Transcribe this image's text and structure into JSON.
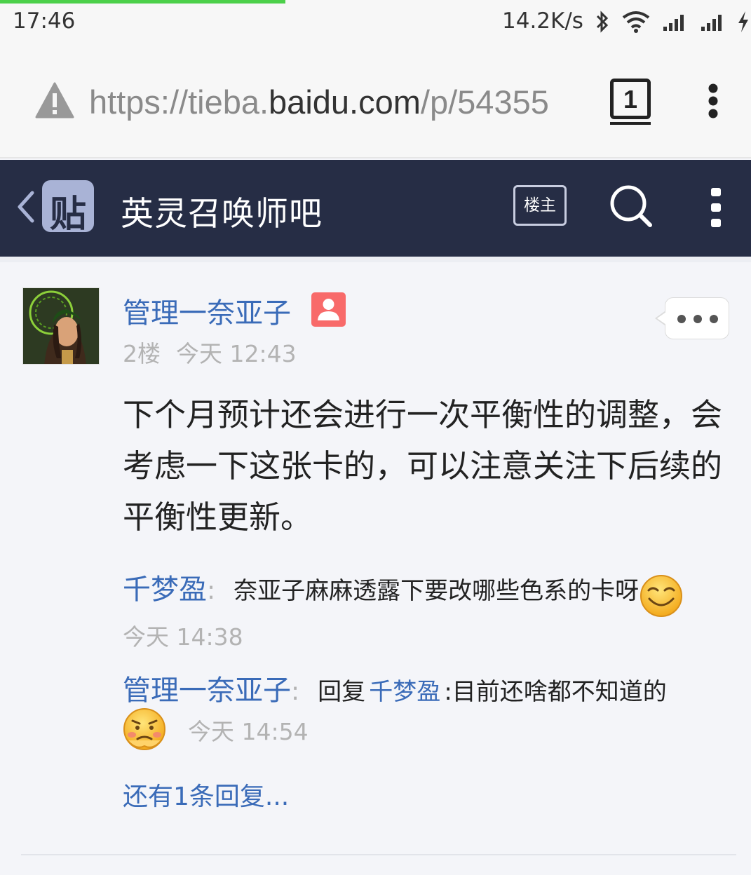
{
  "status_bar": {
    "time": "17:46",
    "net_speed": "14.2K/s",
    "page_load_progress": 0.38,
    "icons": [
      "bluetooth-icon",
      "wifi-icon",
      "signal-icon",
      "signal-icon",
      "charging-icon"
    ]
  },
  "browser": {
    "url_prefix": "https://tieba.",
    "url_host": "baidu.com",
    "url_suffix": "/p/54355",
    "tab_count": "1",
    "security_icon": "warning-icon"
  },
  "header": {
    "logo_text": "贴",
    "forum_title": "英灵召唤师吧",
    "louzhu_label": "楼主",
    "colors": {
      "background": "#262d45",
      "logo": "#a9b3d6"
    }
  },
  "post": {
    "author": "管理一奈亚子",
    "floor": "2楼",
    "time": "今天 12:43",
    "content": "下个月预计还会进行一次平衡性的调整，会考虑一下这张卡的，可以注意关注下后续的平衡性更新。"
  },
  "replies": [
    {
      "user": "千梦盈",
      "colon": ":",
      "text": "奈亚子麻麻透露下要改哪些色系的卡呀",
      "emoji": "smile-emoji",
      "time": "今天 14:38"
    },
    {
      "user": "管理一奈亚子",
      "colon": ":",
      "reply_prefix": "回复",
      "reply_target": "千梦盈",
      "text": ":目前还啥都不知道的",
      "emoji": "worried-emoji",
      "time": "今天 14:54"
    }
  ],
  "more_replies": "还有1条回复...",
  "colors": {
    "link": "#3a6bb8",
    "meta": "#b3b3b3",
    "badge": "#f86a6a"
  }
}
